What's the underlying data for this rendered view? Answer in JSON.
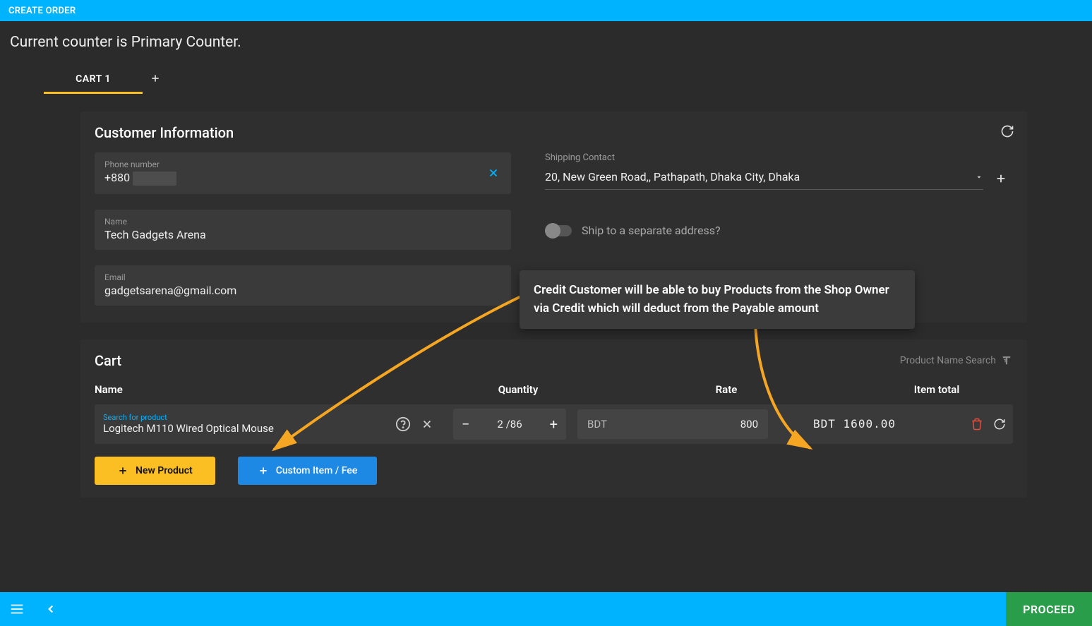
{
  "header": {
    "title": "CREATE ORDER"
  },
  "counter_message": "Current counter is Primary Counter.",
  "tabs": {
    "active": "CART 1"
  },
  "customer": {
    "section_title": "Customer Information",
    "phone_label": "Phone number",
    "phone_value": "+880",
    "name_label": "Name",
    "name_value": "Tech Gadgets Arena",
    "email_label": "Email",
    "email_value": "gadgetsarena@gmail.com",
    "shipping_label": "Shipping Contact",
    "shipping_value": "20, New Green Road,, Pathapath, Dhaka City, Dhaka",
    "ship_separate_label": "Ship to a separate address?"
  },
  "callout": "Credit Customer will be able to buy Products from the Shop Owner via Credit which will deduct from the Payable amount",
  "cart": {
    "section_title": "Cart",
    "product_search_label": "Product Name Search",
    "col_name": "Name",
    "col_qty": "Quantity",
    "col_rate": "Rate",
    "col_total": "Item total",
    "row": {
      "search_label": "Search for product",
      "product": "Logitech M110 Wired Optical Mouse",
      "qty": "2",
      "stock": "86",
      "currency": "BDT",
      "rate": "800",
      "total_currency": "BDT",
      "total_amount": "1600.00"
    },
    "new_product_btn": "New Product",
    "custom_item_btn": "Custom Item / Fee"
  },
  "footer": {
    "proceed": "PROCEED"
  }
}
